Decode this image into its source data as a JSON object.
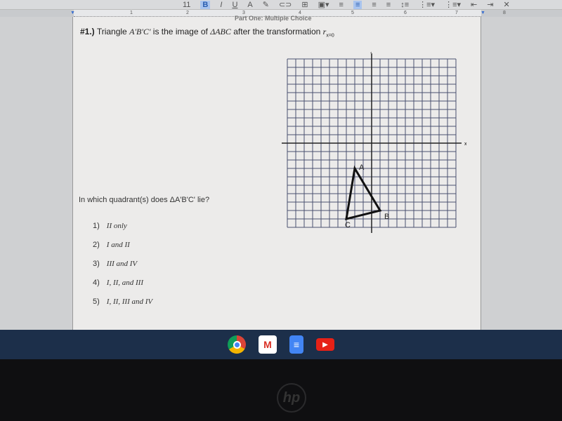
{
  "toolbar": {
    "font_size": "11",
    "items": [
      "B",
      "I",
      "U",
      "A",
      "link",
      "comment",
      "image",
      "align-left",
      "align-center",
      "align-right",
      "justify",
      "line-spacing",
      "numbered-list",
      "bulleted-list",
      "decrease-indent",
      "increase-indent",
      "clear-formatting"
    ]
  },
  "ruler": {
    "marks": [
      "1",
      "2",
      "3",
      "4",
      "5",
      "6",
      "7",
      "8"
    ]
  },
  "document": {
    "header": "Part One: Multiple Choice",
    "q1_number": "#1.)",
    "q1_text_a": "Triangle",
    "q1_image": "A'B'C'",
    "q1_text_b": "is the image of",
    "q1_orig": "ΔABC",
    "q1_text_c": "after the transformation",
    "q1_transform": "r",
    "q1_transform_sub": "x=0",
    "question": "In which quadrant(s) does ΔA'B'C' lie?",
    "choices": [
      {
        "num": "1)",
        "text": "II only"
      },
      {
        "num": "2)",
        "text": "I and II"
      },
      {
        "num": "3)",
        "text": "III and IV"
      },
      {
        "num": "4)",
        "text": "I, II, and III"
      },
      {
        "num": "5)",
        "text": "I, II, III and IV"
      }
    ]
  },
  "chart_data": {
    "type": "scatter",
    "xlabel": "x",
    "ylabel": "y",
    "xlim": [
      -10,
      10
    ],
    "ylim": [
      -10,
      10
    ],
    "grid": true,
    "points": [
      {
        "label": "A",
        "x": -2,
        "y": -3
      },
      {
        "label": "B",
        "x": 1,
        "y": -8
      },
      {
        "label": "C",
        "x": -3,
        "y": -9
      }
    ],
    "polygon": [
      "A",
      "B",
      "C"
    ]
  },
  "taskbar": {
    "apps": [
      "chrome-icon",
      "gmail-icon",
      "docs-icon",
      "youtube-icon"
    ]
  },
  "bezel": {
    "logo": "hp"
  }
}
